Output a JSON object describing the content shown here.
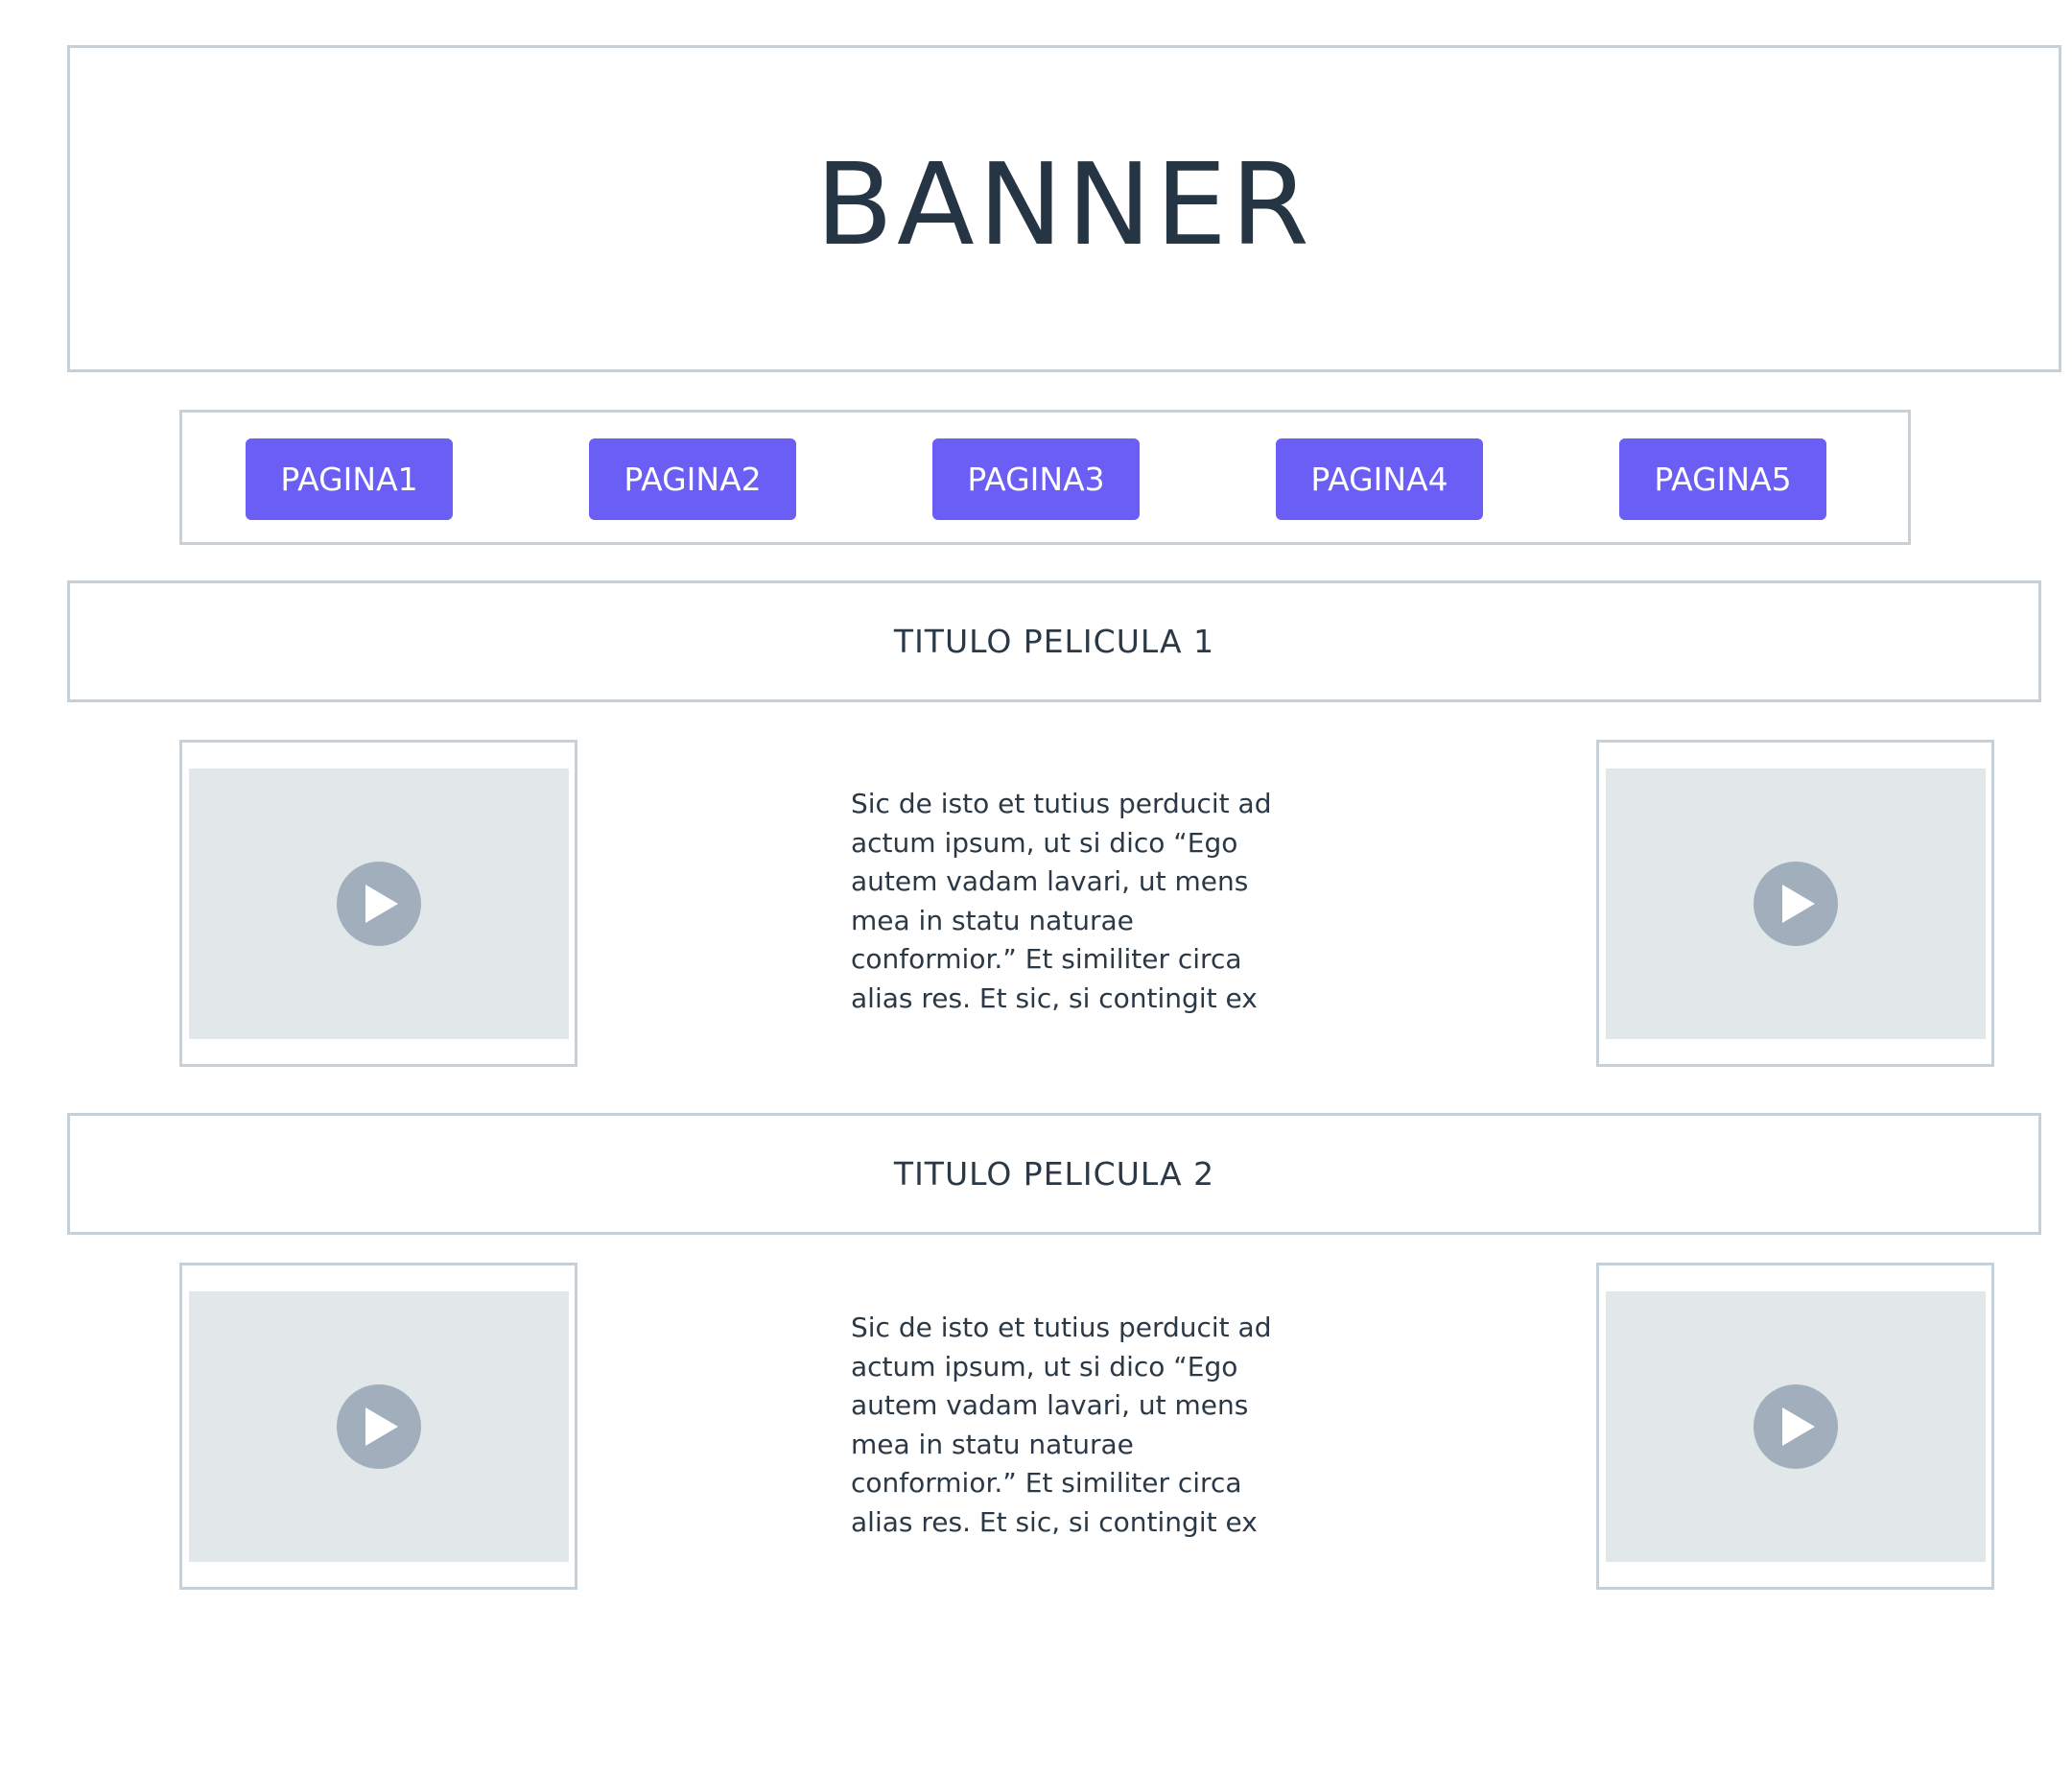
{
  "banner": {
    "title": "BANNER"
  },
  "nav": {
    "items": [
      {
        "label": "PAGINA1"
      },
      {
        "label": "PAGINA2"
      },
      {
        "label": "PAGINA3"
      },
      {
        "label": "PAGINA4"
      },
      {
        "label": "PAGINA5"
      }
    ]
  },
  "movies": [
    {
      "title": "TITULO PELICULA 1",
      "description_lines": [
        "Sic de isto et tutius perducit ad",
        "actum ipsum, ut si dico “Ego",
        "autem vadam lavari, ut mens",
        "mea in statu naturae",
        "conformior.” Et similiter circa",
        "alias res. Et sic, si contingit ex"
      ]
    },
    {
      "title": "TITULO PELICULA 2",
      "description_lines": [
        "Sic de isto et tutius perducit ad",
        "actum ipsum, ut si dico “Ego",
        "autem vadam lavari, ut mens",
        "mea in statu naturae",
        "conformior.” Et similiter circa",
        "alias res. Et sic, si contingit ex"
      ]
    }
  ],
  "colors": {
    "accent": "#6b5ef5",
    "border": "#c6d0d9",
    "placeholder": "#e2e7ea",
    "play_icon_bg": "#a0afbb",
    "text": "#2b3845"
  },
  "icons": {
    "video_play": "play-icon"
  }
}
